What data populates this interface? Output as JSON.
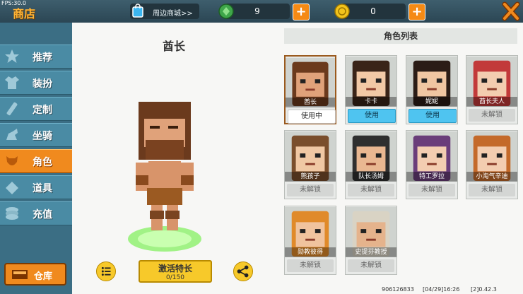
{
  "fps": "FPS:30.0",
  "title": "商店",
  "mall_label": "周边商城>>",
  "currency": {
    "gems": "9",
    "coins": "0",
    "plus": "+"
  },
  "sidebar": [
    {
      "label": "推荐",
      "icon": "recommend-icon"
    },
    {
      "label": "装扮",
      "icon": "outfit-icon"
    },
    {
      "label": "定制",
      "icon": "customize-icon"
    },
    {
      "label": "坐骑",
      "icon": "mount-icon"
    },
    {
      "label": "角色",
      "icon": "character-icon",
      "active": true
    },
    {
      "label": "道具",
      "icon": "props-icon"
    },
    {
      "label": "充值",
      "icon": "recharge-icon"
    }
  ],
  "warehouse_label": "仓库",
  "character": {
    "name": "酋长"
  },
  "activate": {
    "label": "激活特长",
    "progress": "0/150"
  },
  "list_title": "角色列表",
  "characters": [
    {
      "name": "酋长",
      "status": "使用中",
      "hair": "#6b3a1d",
      "skin": "#e0a27a"
    },
    {
      "name": "卡卡",
      "status": "使用",
      "hair": "#3a2418",
      "skin": "#f2c9a6"
    },
    {
      "name": "妮妮",
      "status": "使用",
      "hair": "#2b1c16",
      "skin": "#f0c6a2"
    },
    {
      "name": "酋长夫人",
      "status": "未解锁",
      "hair": "#c23a3a",
      "skin": "#f3cdb0"
    },
    {
      "name": "熊孩子",
      "status": "未解锁",
      "hair": "#7a4e2c",
      "skin": "#f0c8a4"
    },
    {
      "name": "队长汤姆",
      "status": "未解锁",
      "hair": "#2f2f2f",
      "skin": "#e9b791"
    },
    {
      "name": "特工罗拉",
      "status": "未解锁",
      "hair": "#6a3d7a",
      "skin": "#f3cdb1"
    },
    {
      "name": "小淘气辛迪",
      "status": "未解锁",
      "hair": "#c46a2a",
      "skin": "#f3cdb0"
    },
    {
      "name": "勋教彼得",
      "status": "未解锁",
      "hair": "#e08a2a",
      "skin": "#f0c39e"
    },
    {
      "name": "史提芬教授",
      "status": "未解锁",
      "hair": "#d9d3c4",
      "skin": "#e5b38c"
    }
  ],
  "footer": {
    "id": "906126833",
    "date": "[04/29]16:26",
    "version": "[2]0.42.3"
  }
}
